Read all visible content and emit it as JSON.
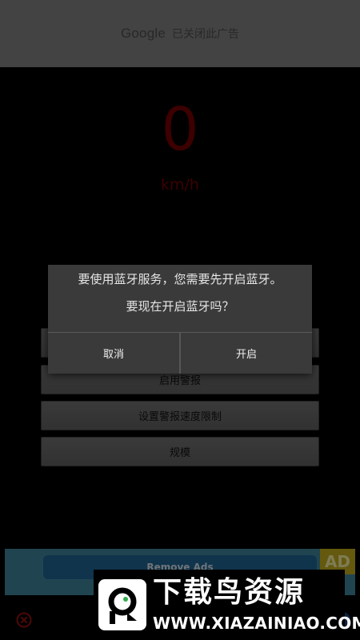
{
  "ad_top": {
    "brand": "Google",
    "status": "已关闭此广告"
  },
  "speedometer": {
    "value": "0",
    "unit": "km/h",
    "color": "#6e0000"
  },
  "menu": {
    "items": [
      {
        "label": ""
      },
      {
        "label": "启用警报"
      },
      {
        "label": "设置警报速度限制"
      },
      {
        "label": "规模"
      }
    ]
  },
  "dialog": {
    "message_line1": "要使用蓝牙服务，您需要先开启蓝牙。",
    "message_line2": "要现在开启蓝牙吗？",
    "cancel_label": "取消",
    "confirm_label": "开启"
  },
  "ad_bottom": {
    "remove_ads_label": "Remove Ads",
    "badge": "AD"
  },
  "watermark": {
    "title": "下载鸟资源",
    "url": "WWW.XIAZAINIAO.COM"
  },
  "icons": {
    "close": "close-circle-icon",
    "logo": "bird-logo-icon"
  }
}
